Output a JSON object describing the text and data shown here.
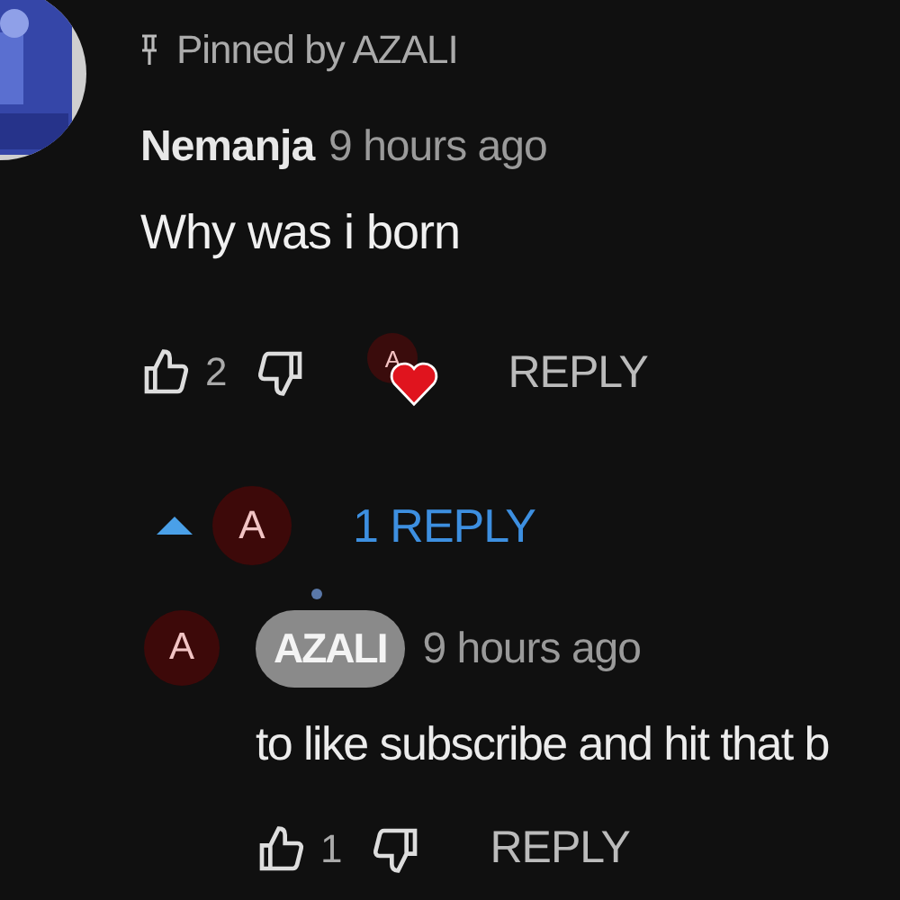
{
  "comment": {
    "pinned_label": "Pinned by AZALI",
    "author": "Nemanja",
    "time": "9 hours ago",
    "text": "Why was i born",
    "likes": "2",
    "hearted": true,
    "creator_initial": "A",
    "reply_label": "REPLY"
  },
  "replies_toggle": {
    "expanded": true,
    "avatar_initial": "A",
    "label": "1 REPLY"
  },
  "replies": [
    {
      "avatar_initial": "A",
      "author": "AZALI",
      "author_is_owner": true,
      "time": "9 hours ago",
      "text": "to like subscribe and hit that b",
      "likes": "1",
      "reply_label": "REPLY"
    }
  ]
}
